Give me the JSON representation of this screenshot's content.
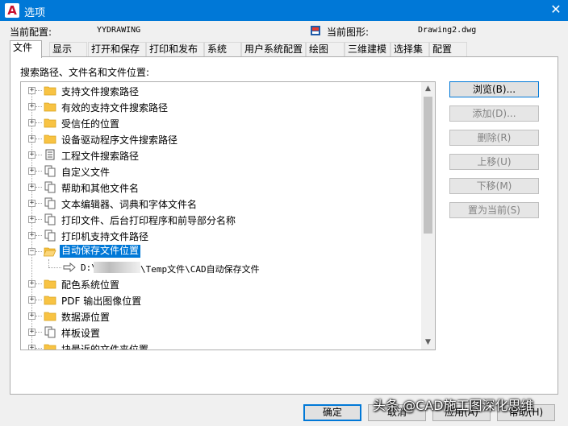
{
  "window": {
    "title": "选项",
    "close_glyph": "✕",
    "app_icon": "autocad-a-icon",
    "app_icon_glyph": "A"
  },
  "profile": {
    "current_profile_label": "当前配置:",
    "current_profile_value": "YYDRAWING",
    "current_drawing_label": "当前图形:",
    "current_drawing_value": "Drawing2.dwg",
    "drawing_icon": "drawing-file-icon"
  },
  "tabs": [
    {
      "label": "文件",
      "active": true
    },
    {
      "label": "显示"
    },
    {
      "label": "打开和保存"
    },
    {
      "label": "打印和发布"
    },
    {
      "label": "系统"
    },
    {
      "label": "用户系统配置"
    },
    {
      "label": "绘图"
    },
    {
      "label": "三维建模"
    },
    {
      "label": "选择集"
    },
    {
      "label": "配置"
    }
  ],
  "panel": {
    "caption": "搜索路径、文件名和文件位置:"
  },
  "tree": {
    "items": [
      {
        "label": "支持文件搜索路径",
        "icon": "folder-icon",
        "expander": "+"
      },
      {
        "label": "有效的支持文件搜索路径",
        "icon": "folder-icon",
        "expander": "+"
      },
      {
        "label": "受信任的位置",
        "icon": "folder-icon",
        "expander": "+"
      },
      {
        "label": "设备驱动程序文件搜索路径",
        "icon": "folder-icon",
        "expander": "+"
      },
      {
        "label": "工程文件搜索路径",
        "icon": "project-file-icon",
        "expander": "+"
      },
      {
        "label": "自定义文件",
        "icon": "file-stack-icon",
        "expander": "+"
      },
      {
        "label": "帮助和其他文件名",
        "icon": "file-stack-icon",
        "expander": "+"
      },
      {
        "label": "文本编辑器、词典和字体文件名",
        "icon": "file-stack-icon",
        "expander": "+"
      },
      {
        "label": "打印文件、后台打印程序和前导部分名称",
        "icon": "file-stack-icon",
        "expander": "+"
      },
      {
        "label": "打印机支持文件路径",
        "icon": "file-stack-icon",
        "expander": "+"
      },
      {
        "label": "自动保存文件位置",
        "icon": "open-folder-icon",
        "expander": "−",
        "selected": true
      },
      {
        "label": "配色系统位置",
        "icon": "folder-icon",
        "expander": "+"
      },
      {
        "label": "PDF 输出图像位置",
        "icon": "folder-icon",
        "expander": "+"
      },
      {
        "label": "数据源位置",
        "icon": "folder-icon",
        "expander": "+"
      },
      {
        "label": "样板设置",
        "icon": "file-stack-icon",
        "expander": "+"
      },
      {
        "label": "块最近的文件夹位置",
        "icon": "folder-icon",
        "expander": "+"
      }
    ],
    "child": {
      "prefix": "D:\\",
      "suffix": "\\Temp文件\\CAD自动保存文件",
      "icon": "arrow-right-icon"
    },
    "scroll": {
      "up": "▲",
      "down": "▼"
    }
  },
  "side_buttons": [
    {
      "label": "浏览(B)...",
      "enabled": true
    },
    {
      "label": "添加(D)...",
      "enabled": false
    },
    {
      "label": "删除(R)",
      "enabled": false
    },
    {
      "label": "上移(U)",
      "enabled": false
    },
    {
      "label": "下移(M)",
      "enabled": false
    },
    {
      "label": "置为当前(S)",
      "enabled": false
    }
  ],
  "footer": {
    "ok": "确定",
    "cancel": "取消",
    "apply": "应用(A)",
    "help": "帮助(H)"
  },
  "watermark": "头条 @CAD施工图深化思维",
  "colors": {
    "titlebar": "#0078d7",
    "selection": "#0078d7",
    "folder": "#f8c343"
  }
}
